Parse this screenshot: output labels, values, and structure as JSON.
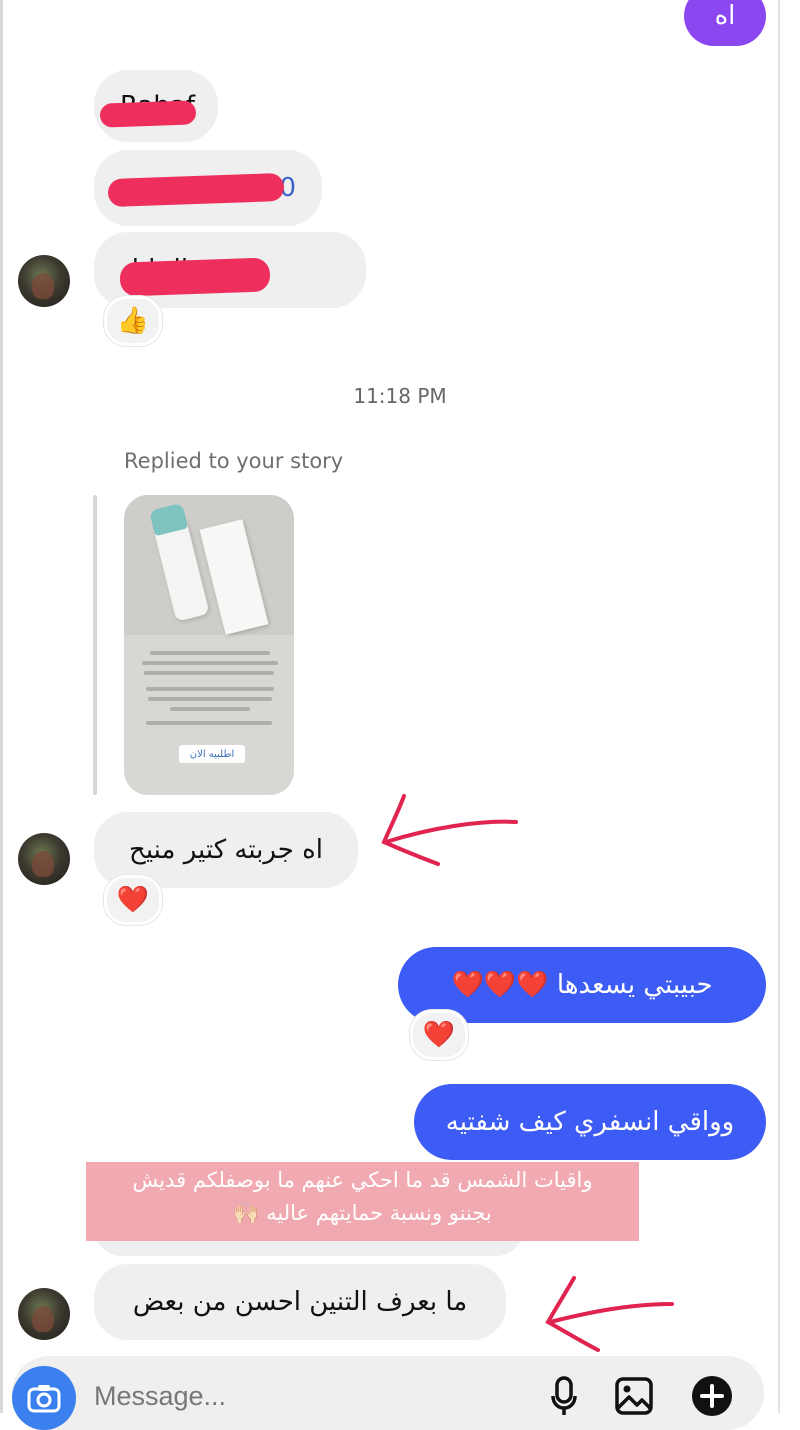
{
  "top_bubble": {
    "text": "اه"
  },
  "incoming_top": {
    "name_text": "Rahaf",
    "phone_text": "0",
    "location_text": "الخليل",
    "reaction": "👍"
  },
  "timestamp": "11:18 PM",
  "story_reply": {
    "label": "Replied to your story",
    "story_cta": "اطلبيه الان"
  },
  "messages": {
    "reply1": "اه جربته كتير منيح",
    "reply1_reaction": "❤️",
    "out1": "حبيبتي يسعدها ❤️❤️❤️",
    "out1_reaction": "❤️",
    "out2": "وواقي انسفري كيف شفتيه",
    "overlay_line1": "واقيات الشمس قد ما احكي عنهم ما بوصفلكم قديش",
    "overlay_line2": "بجننو ونسبة حمايتهم عاليه 🙌🏻",
    "reply2": "ما بعرف التنين احسن من بعض"
  },
  "composer": {
    "placeholder": "Message...",
    "icons": [
      "camera-icon",
      "microphone-icon",
      "gallery-icon",
      "plus-icon"
    ]
  },
  "colors": {
    "outgoing_bubble": "#3d5bf5",
    "incoming_bubble": "#efefef",
    "camera_button": "#3b80ee",
    "redaction": "#ee2f5e",
    "annotation_arrow": "#e0234f"
  }
}
